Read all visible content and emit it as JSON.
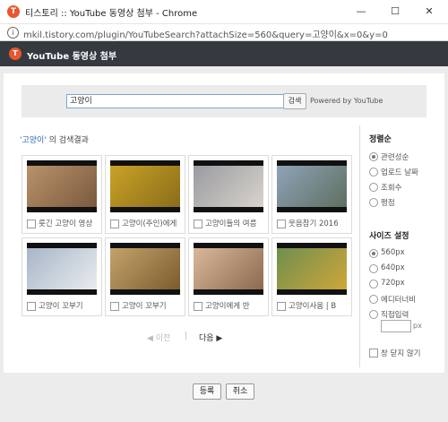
{
  "window": {
    "app_icon_letter": "T",
    "title": "티스토리 :: YouTube 동영상 첨부 - Chrome",
    "minimize_glyph": "—",
    "maximize_glyph": "☐",
    "close_glyph": "✕"
  },
  "address": {
    "url": "mkil.tistory.com/plugin/YouTubeSearch?attachSize=560&query=고양이&x=0&y=0"
  },
  "dialog": {
    "logo_letter": "T",
    "title": "YouTube 동영상 첨부"
  },
  "search": {
    "value": "고양이",
    "button_label": "검색",
    "powered_by": "Powered by YouTube"
  },
  "results": {
    "keyword": "'고양이'",
    "suffix": " 의 검색결과",
    "items": [
      {
        "title": "릇긴 고양이 영상",
        "thumb_colors": [
          "#b9926b",
          "#7a5a3e"
        ]
      },
      {
        "title": "고양이(주인)에게",
        "thumb_colors": [
          "#c9a227",
          "#8a6d1a"
        ]
      },
      {
        "title": "고양이들의 여름",
        "thumb_colors": [
          "#9a9aa0",
          "#d8d4cc"
        ]
      },
      {
        "title": "웃음참기 2016",
        "thumb_colors": [
          "#8fa3b8",
          "#5e6f60"
        ]
      },
      {
        "title": "고양이 꼬부기",
        "thumb_colors": [
          "#a8b6c8",
          "#e9ecef"
        ]
      },
      {
        "title": "고양이 꼬부기",
        "thumb_colors": [
          "#c4a36a",
          "#7b5c2e"
        ]
      },
      {
        "title": "고양이에게 반",
        "thumb_colors": [
          "#d9b89a",
          "#8c6a50"
        ]
      },
      {
        "title": "고양이사움 | B",
        "thumb_colors": [
          "#6f8f4e",
          "#cfa63a"
        ]
      }
    ]
  },
  "pager": {
    "prev": "◀ 이전",
    "separator": "|",
    "next": "다음 ▶"
  },
  "sort": {
    "heading": "정렬순",
    "options": [
      "관련성순",
      "업로드 날짜",
      "조회수",
      "평점"
    ],
    "selected_index": 0
  },
  "size": {
    "heading": "사이즈 설정",
    "options": [
      "560px",
      "640px",
      "720px",
      "에디터너비",
      "직접입력"
    ],
    "selected_index": 0,
    "custom_unit": "px",
    "custom_value": ""
  },
  "keep_open_label": "창 닫지 않기",
  "footer": {
    "register": "등록",
    "cancel": "취소"
  }
}
